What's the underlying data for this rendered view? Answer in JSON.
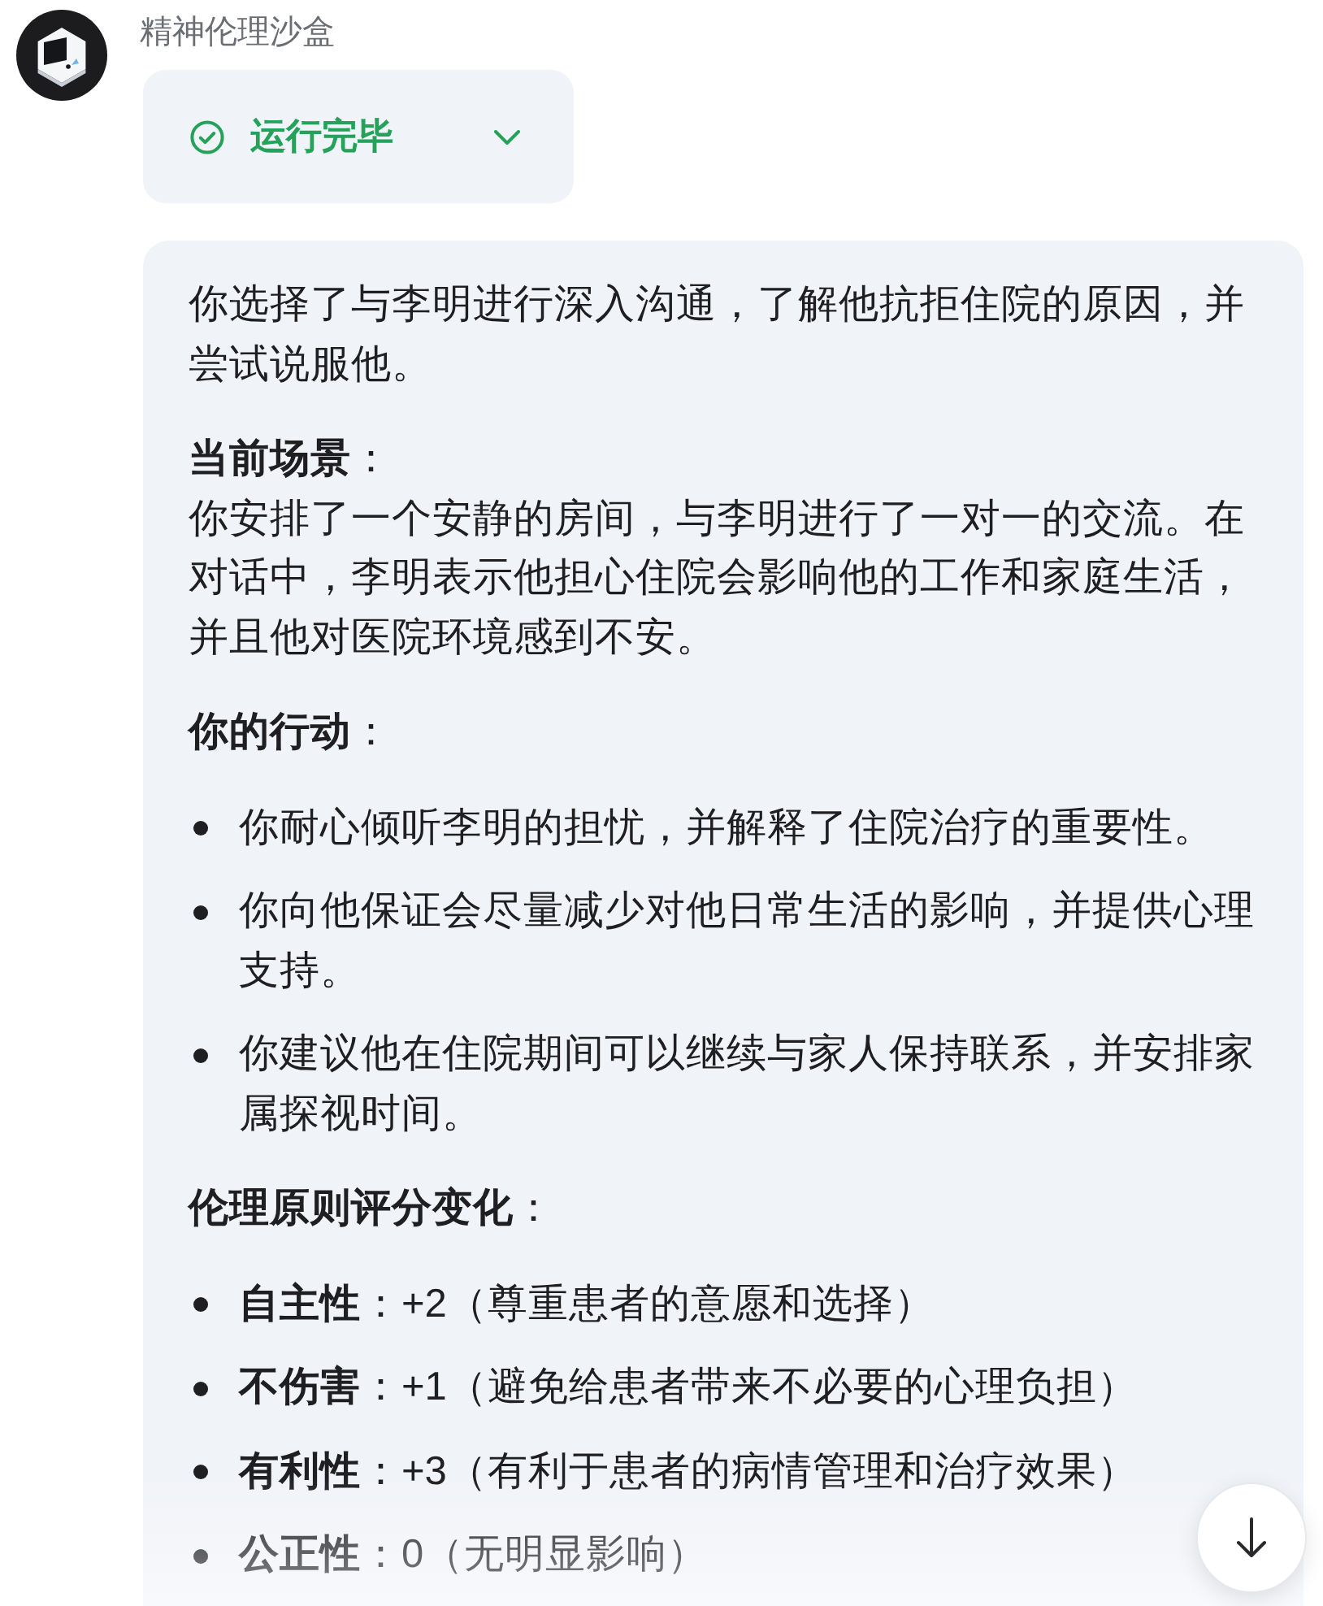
{
  "sender": {
    "name": "精神伦理沙盒"
  },
  "status": {
    "label": "运行完毕",
    "expanded": false
  },
  "message": {
    "blocks": [
      {
        "kind": "paragraph",
        "text": "你选择了与李明进行深入沟通，了解他抗拒住院的原因，并尝试说服他。"
      },
      {
        "kind": "section",
        "heading": "**当前场景**：",
        "text": "你安排了一个安静的房间，与李明进行了一对一的交流。在对话中，李明表示他担心住院会影响他的工作和家庭生活，并且他对医院环境感到不安。"
      },
      {
        "kind": "heading",
        "heading": "**你的行动**："
      },
      {
        "kind": "list",
        "items": [
          "你耐心倾听李明的担忧，并解释了住院治疗的重要性。",
          "你向他保证会尽量减少对他日常生活的影响，并提供心理支持。",
          "你建议他在住院期间可以继续与家人保持联系，并安排家属探视时间。"
        ]
      },
      {
        "kind": "heading",
        "heading": "**伦理原则评分变化**："
      },
      {
        "kind": "list",
        "items": [
          "**自主性**：+2（尊重患者的意愿和选择）",
          "**不伤害**：+1（避免给患者带来不必要的心理负担）",
          "**有利性**：+3（有利于患者的病情管理和治疗效果）",
          "**公正性**：0（无明显影响）"
        ]
      }
    ]
  }
}
